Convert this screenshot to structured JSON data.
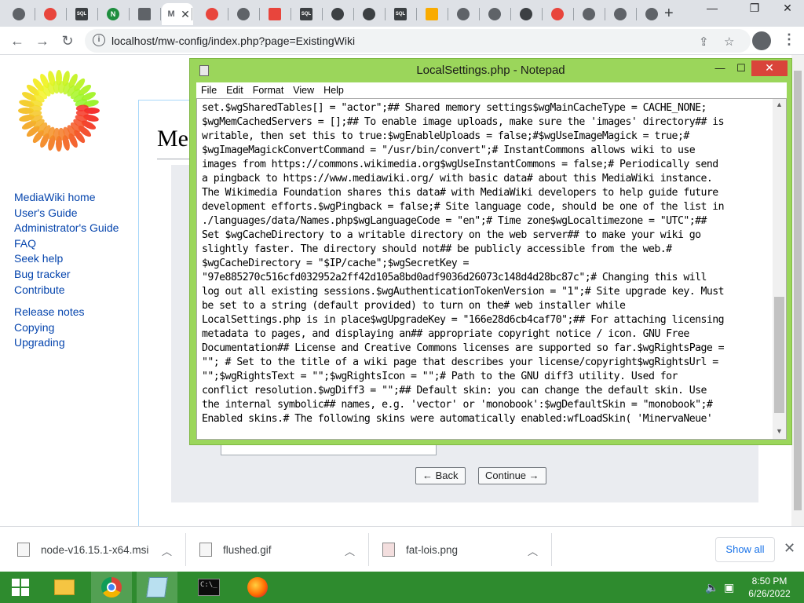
{
  "browser": {
    "tabs": [
      {
        "icon": "circle-gray",
        "color": "#5f6368"
      },
      {
        "icon": "red-app",
        "color": "#e8453c"
      },
      {
        "icon": "sql-square",
        "color": "#3c4043",
        "text": "SQL"
      },
      {
        "icon": "green-n",
        "color": "#1e8e3e",
        "text": "N"
      },
      {
        "icon": "download",
        "color": "#5f6368"
      },
      {
        "icon": "active-tab",
        "color": "#5f6368",
        "text": "M"
      },
      {
        "icon": "opera-red",
        "color": "#e8453c"
      },
      {
        "icon": "circle-gray",
        "color": "#5f6368"
      },
      {
        "icon": "calendar-red",
        "color": "#e8453c"
      },
      {
        "icon": "sql-square",
        "color": "#3c4043",
        "text": "SQL"
      },
      {
        "icon": "github",
        "color": "#3c4043"
      },
      {
        "icon": "diamond",
        "color": "#3c4043"
      },
      {
        "icon": "sql-square",
        "color": "#3c4043",
        "text": "SQL"
      },
      {
        "icon": "bookmark-yellow",
        "color": "#f9ab00"
      },
      {
        "icon": "gear",
        "color": "#5f6368"
      },
      {
        "icon": "circle-gray",
        "color": "#5f6368"
      },
      {
        "icon": "power",
        "color": "#3c4043"
      },
      {
        "icon": "opera-red",
        "color": "#e8453c"
      },
      {
        "icon": "circle-gray",
        "color": "#5f6368"
      },
      {
        "icon": "circle-gray",
        "color": "#5f6368"
      },
      {
        "icon": "gear",
        "color": "#5f6368"
      }
    ],
    "active_tab_close": "✕",
    "new_tab": "+",
    "url": "localhost/mw-config/index.php?page=ExistingWiki"
  },
  "page": {
    "title_fragment": "Me",
    "sidebar": {
      "group1": [
        "MediaWiki home",
        "User's Guide",
        "Administrator's Guide",
        "FAQ",
        "Seek help",
        "Bug tracker",
        "Contribute"
      ],
      "group2": [
        "Release notes",
        "Copying",
        "Upgrading"
      ]
    },
    "back_button": "← Back",
    "continue_button": "Continue →"
  },
  "notepad": {
    "title": "LocalSettings.php - Notepad",
    "menu": [
      "File",
      "Edit",
      "Format",
      "View",
      "Help"
    ],
    "lines": [
      "set.$wgSharedTables[] = \"actor\";## Shared memory settings$wgMainCacheType = CACHE_NONE;",
      "$wgMemCachedServers = [];## To enable image uploads, make sure the 'images' directory## is",
      "writable, then set this to true:$wgEnableUploads = false;#$wgUseImageMagick = true;#",
      "$wgImageMagickConvertCommand = \"/usr/bin/convert\";# InstantCommons allows wiki to use",
      "images from https://commons.wikimedia.org$wgUseInstantCommons = false;# Periodically send",
      "a pingback to https://www.mediawiki.org/ with basic data# about this MediaWiki instance.",
      "The Wikimedia Foundation shares this data# with MediaWiki developers to help guide future",
      "development efforts.$wgPingback = false;# Site language code, should be one of the list in",
      "./languages/data/Names.php$wgLanguageCode = \"en\";# Time zone$wgLocaltimezone = \"UTC\";##",
      "Set $wgCacheDirectory to a writable directory on the web server## to make your wiki go",
      "slightly faster. The directory should not## be publicly accessible from the web.#",
      "$wgCacheDirectory = \"$IP/cache\";$wgSecretKey =",
      "\"97e885270c516cfd032952a2ff42d105a8bd0adf9036d26073c148d4d28bc87c\";# Changing this will",
      "log out all existing sessions.$wgAuthenticationTokenVersion = \"1\";# Site upgrade key. Must",
      "be set to a string (default provided) to turn on the# web installer while",
      "LocalSettings.php is in place$wgUpgradeKey = \"166e28d6cb4caf70\";## For attaching licensing",
      "metadata to pages, and displaying an## appropriate copyright notice / icon. GNU Free",
      "Documentation## License and Creative Commons licenses are supported so far.$wgRightsPage =",
      "\"\"; # Set to the title of a wiki page that describes your license/copyright$wgRightsUrl =",
      "\"\";$wgRightsText = \"\";$wgRightsIcon = \"\";# Path to the GNU diff3 utility. Used for",
      "conflict resolution.$wgDiff3 = \"\";## Default skin: you can change the default skin. Use",
      "the internal symbolic## names, e.g. 'vector' or 'monobook':$wgDefaultSkin = \"monobook\";#",
      "Enabled skins.# The following skins were automatically enabled:wfLoadSkin( 'MinervaNeue'"
    ]
  },
  "downloads": {
    "items": [
      "node-v16.15.1-x64.msi",
      "flushed.gif",
      "fat-lois.png"
    ],
    "show_all": "Show all"
  },
  "taskbar": {
    "time": "8:50 PM",
    "date": "6/26/2022"
  },
  "colors": {
    "notepad_frame": "#9bd65b",
    "taskbar": "#2e8b2e",
    "link": "#0645ad"
  }
}
